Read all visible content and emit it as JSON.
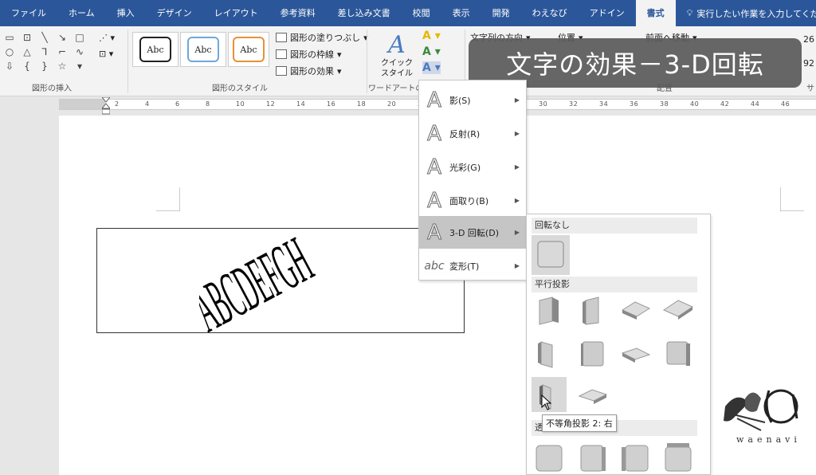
{
  "tabs": [
    "ファイル",
    "ホーム",
    "挿入",
    "デザイン",
    "レイアウト",
    "参考資料",
    "差し込み文書",
    "校閲",
    "表示",
    "開発",
    "わえなび",
    "アドイン",
    "書式"
  ],
  "active_tab": "書式",
  "tell_me": "実行したい作業を入力してください",
  "ribbon": {
    "group_insert_shapes": "図形の挿入",
    "group_shape_styles": "図形のスタイル",
    "group_wordart": "ワードアートの",
    "group_arrange": "配置",
    "style_sample": "Abc",
    "fill": "図形の塗りつぶし",
    "outline": "図形の枠線",
    "effects": "図形の効果",
    "quick_style_1": "クイック",
    "quick_style_2": "スタイル",
    "text_direction": "文字列の方向",
    "position": "位置",
    "bring_forward": "前面へ移動",
    "size_1": "26",
    "size_2": "92",
    "edge_label": "サ"
  },
  "banner": "文字の効果－3-D回転",
  "wordart_text": "ABCDEFGH",
  "menu": [
    {
      "label": "影(S)"
    },
    {
      "label": "反射(R)"
    },
    {
      "label": "光彩(G)"
    },
    {
      "label": "面取り(B)"
    },
    {
      "label": "3-D 回転(D)"
    },
    {
      "label": "変形(T)"
    }
  ],
  "menu_glyph": "A",
  "menu_transform_glyph": "abc",
  "gallery": {
    "section_none": "回転なし",
    "section_parallel": "平行投影",
    "section_perspective": "透"
  },
  "tooltip": "不等角投影 2: 右",
  "logo_text": "waenavi",
  "colors": {
    "tab_bar": "#2b579a",
    "highlight": "#c5c5c5",
    "banner": "#5a5a5a"
  }
}
